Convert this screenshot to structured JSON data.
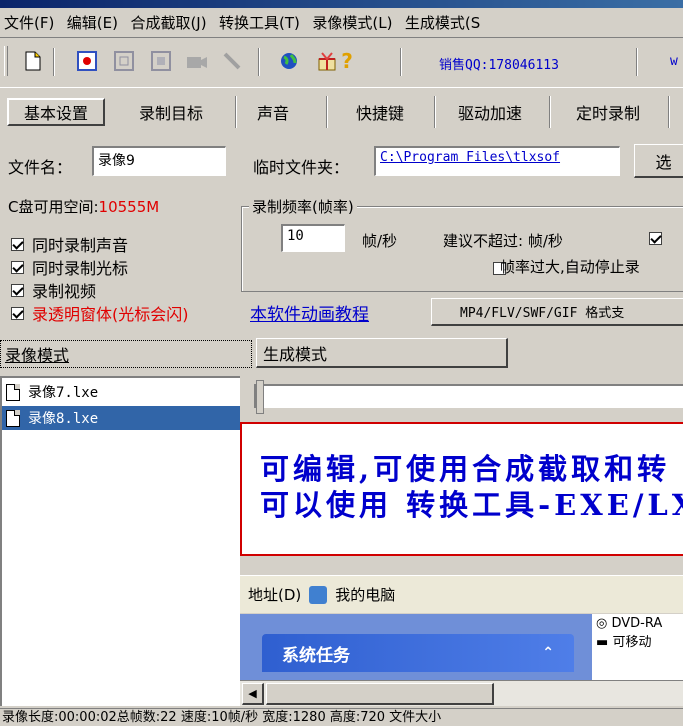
{
  "menu": [
    "文件(F)",
    "编辑(E)",
    "合成截取(J)",
    "转换工具(T)",
    "录像模式(L)",
    "生成模式(S"
  ],
  "toolbar": {
    "icons": [
      "new-file-icon",
      "record-icon",
      "pause-icon",
      "stop-icon",
      "camera-icon",
      "pen-icon",
      "globe-icon",
      "gift-icon",
      "help-icon"
    ],
    "qq_text": "销售QQ:178046113",
    "right_cut": "w"
  },
  "tabs": [
    "基本设置",
    "录制目标",
    "声音",
    "快捷键",
    "驱动加速",
    "定时录制"
  ],
  "form": {
    "filename_label": "文件名：",
    "filename_value": "录像9",
    "tempdir_label": "临时文件夹：",
    "tempdir_value": "C:\\Program Files\\tlxsof",
    "browse_label": "选",
    "disk_label": "C盘可用空间:",
    "disk_value": "10555M",
    "fps_group_title": "录制频率(帧率)",
    "fps_value": "10",
    "fps_unit": "帧/秒",
    "suggest_text": "建议不超过: 帧/秒",
    "auto_stop_text": "帧率过大,自动停止录",
    "checks": [
      {
        "label": "同时录制声音",
        "checked": true
      },
      {
        "label": "同时录制光标",
        "checked": true
      },
      {
        "label": "录制视频",
        "checked": true
      },
      {
        "label": "录透明窗体(光标会闪)",
        "checked": true
      }
    ],
    "right_check_checked": true,
    "auto_stop_checked": false,
    "tutorial_link": "本软件动画教程",
    "format_button": "MP4/FLV/SWF/GIF  格式支"
  },
  "mode_tabs": [
    "录像模式",
    "生成模式"
  ],
  "files": [
    {
      "name": "录像7.lxe",
      "selected": false
    },
    {
      "name": "录像8.lxe",
      "selected": true
    }
  ],
  "preview": {
    "line1": "可编辑,可使用合成截取和转",
    "line2": "可以使用 转换工具-EXE/LX",
    "address_label": "地址(D)",
    "address_value": "我的电脑",
    "task_pane_title": "系统任务",
    "drive1": "DVD-RA",
    "drive2": "可移动"
  },
  "statusbar": "录像长度:00:00:02总帧数:22 速度:10帧/秒 宽度:1280 高度:720 文件大小"
}
